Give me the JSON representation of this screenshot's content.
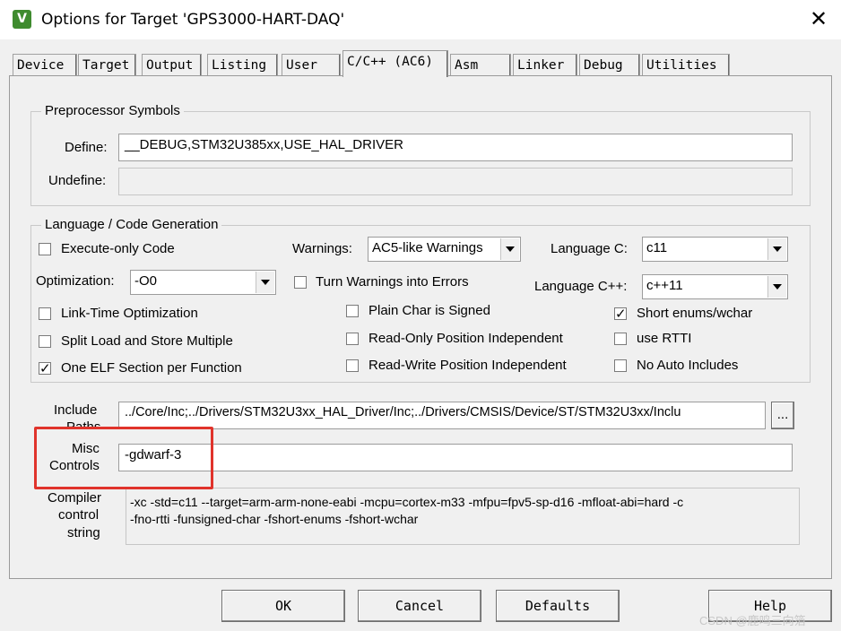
{
  "window": {
    "title": "Options for Target 'GPS3000-HART-DAQ'",
    "icon": "keil-uvision-icon",
    "close_glyph": "✕"
  },
  "tabs": [
    "Device",
    "Target",
    "Output",
    "Listing",
    "User",
    "C/C++ (AC6)",
    "Asm",
    "Linker",
    "Debug",
    "Utilities"
  ],
  "active_tab": "C/C++ (AC6)",
  "preprocessor": {
    "group_title": "Preprocessor Symbols",
    "define_label": "Define:",
    "define_value": "__DEBUG,STM32U385xx,USE_HAL_DRIVER",
    "undefine_label": "Undefine:",
    "undefine_value": ""
  },
  "language": {
    "group_title": "Language / Code Generation",
    "execute_only": {
      "label": "Execute-only Code",
      "checked": false
    },
    "optimization_label": "Optimization:",
    "optimization_value": "-O0",
    "lto": {
      "label": "Link-Time Optimization",
      "checked": false
    },
    "split_load": {
      "label": "Split Load and Store Multiple",
      "checked": false
    },
    "one_elf": {
      "label": "One ELF Section per Function",
      "checked": true
    },
    "warnings_label": "Warnings:",
    "warnings_value": "AC5-like Warnings",
    "turn_warnings": {
      "label": "Turn Warnings into Errors",
      "checked": false
    },
    "plain_char": {
      "label": "Plain Char is Signed",
      "checked": false
    },
    "ro_pi": {
      "label": "Read-Only Position Independent",
      "checked": false
    },
    "rw_pi": {
      "label": "Read-Write Position Independent",
      "checked": false
    },
    "lang_c_label": "Language C:",
    "lang_c_value": "c11",
    "lang_cpp_label": "Language C++:",
    "lang_cpp_value": "c++11",
    "short_enums": {
      "label": "Short enums/wchar",
      "checked": true
    },
    "use_rtti": {
      "label": "use RTTI",
      "checked": false
    },
    "no_auto": {
      "label": "No Auto Includes",
      "checked": false
    }
  },
  "include": {
    "label_line1": "Include",
    "label_line2": "Paths",
    "value": "../Core/Inc;../Drivers/STM32U3xx_HAL_Driver/Inc;../Drivers/CMSIS/Device/ST/STM32U3xx/Inclu",
    "browse_label": "..."
  },
  "misc": {
    "label_line1": "Misc",
    "label_line2": "Controls",
    "value": "-gdwarf-3",
    "highlight_color": "#e0332b"
  },
  "compiler": {
    "label_line1": "Compiler",
    "label_line2": "control",
    "label_line3": "string",
    "line1": "-xc -std=c11 --target=arm-arm-none-eabi -mcpu=cortex-m33 -mfpu=fpv5-sp-d16 -mfloat-abi=hard -c",
    "line2": "-fno-rtti -funsigned-char -fshort-enums -fshort-wchar"
  },
  "buttons": {
    "ok": "OK",
    "cancel": "Cancel",
    "defaults": "Defaults",
    "help": "Help"
  },
  "watermark": "CSDN @鹿鸣三向箔"
}
